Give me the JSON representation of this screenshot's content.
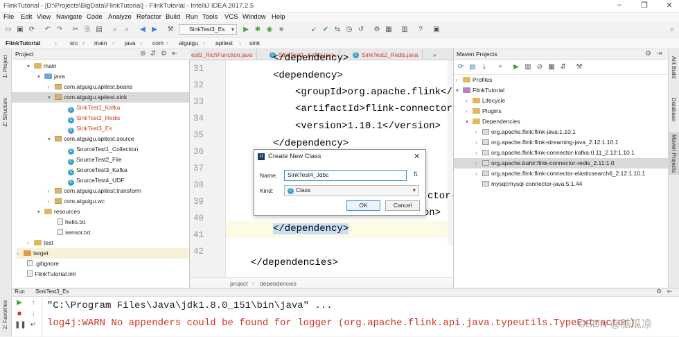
{
  "window": {
    "title": "FlinkTutorial - [D:\\Projects\\BigData\\FlinkTutorial] - FlinkTutorial - IntelliJ IDEA 2017.2.5"
  },
  "menu": [
    "File",
    "Edit",
    "View",
    "Navigate",
    "Code",
    "Analyze",
    "Refactor",
    "Build",
    "Run",
    "Tools",
    "VCS",
    "Window",
    "Help"
  ],
  "toolbar": {
    "run_config": "SinkTest3_Es"
  },
  "breadcrumb": [
    "FlinkTutorial",
    "src",
    "main",
    "java",
    "com",
    "atguigu",
    "apitest",
    "sink"
  ],
  "left_strip": {
    "project": "1: Project",
    "structure": "Z: Structure",
    "favorites": "2: Favorites"
  },
  "project_panel": {
    "header": "Project",
    "tree": [
      {
        "label": "main",
        "type": "folder"
      },
      {
        "label": "java",
        "type": "folder"
      },
      {
        "label": "com.atguigu.apitest.beans",
        "type": "pkg"
      },
      {
        "label": "com.atguigu.apitest.sink",
        "type": "pkg"
      },
      {
        "label": "SinkTest1_Kafka",
        "type": "cls"
      },
      {
        "label": "SinkTest2_Redis",
        "type": "cls"
      },
      {
        "label": "SinkTest3_Es",
        "type": "cls"
      },
      {
        "label": "com.atguigu.apitest.source",
        "type": "pkg"
      },
      {
        "label": "SourceTest1_Collection",
        "type": "cls"
      },
      {
        "label": "SourceTest2_File",
        "type": "cls"
      },
      {
        "label": "SourceTest3_Kafka",
        "type": "cls"
      },
      {
        "label": "SourceTest4_UDF",
        "type": "cls"
      },
      {
        "label": "com.atguigu.apitest.transform",
        "type": "pkg"
      },
      {
        "label": "com.atguigu.wc",
        "type": "pkg"
      },
      {
        "label": "resources",
        "type": "folder"
      },
      {
        "label": "hello.txt",
        "type": "file"
      },
      {
        "label": "sensor.txt",
        "type": "file"
      },
      {
        "label": "test",
        "type": "folder"
      },
      {
        "label": "target",
        "type": "folder"
      },
      {
        "label": ".gitignore",
        "type": "file"
      },
      {
        "label": "FlinkTutorial.iml",
        "type": "file"
      }
    ]
  },
  "editor": {
    "tabs": [
      "est5_RichFunction.java",
      "SinkTest1_Kafka.java",
      "SinkTest2_Redis.java"
    ],
    "line_numbers": [
      "31",
      "32",
      "33",
      "34",
      "35",
      "36",
      "37",
      "38",
      "39",
      "40",
      "41",
      "42"
    ],
    "lines": {
      "l31": "</dependency>",
      "l32": "<dependency>",
      "l33g": "<groupId>",
      "l33v": "org.apache.flink",
      "l33c": "</gr",
      "l34a": "<artifactId>",
      "l34v": "flink-connector-e",
      "l35v": "<version>",
      "l35n": "1.10.1",
      "l35c": "</version>",
      "l36": "</dependency>",
      "l38": "ctor-j",
      "l39a": "<version>",
      "l39b": "5.1.44",
      "l39c": "</version>",
      "l40": "</dependency>",
      "l42": "</dependencies>"
    },
    "crumbs": [
      "project",
      "dependencies"
    ]
  },
  "dialog": {
    "title": "Create New Class",
    "name_label": "Name:",
    "name_value": "SinkTest4_Jdbc",
    "kind_label": "Kind:",
    "kind_value": "Class",
    "ok": "OK",
    "cancel": "Cancel"
  },
  "maven": {
    "header": "Maven Projects",
    "items": [
      {
        "label": "Profiles",
        "indent": 0
      },
      {
        "label": "FlinkTutorial",
        "indent": 0
      },
      {
        "label": "Lifecycle",
        "indent": 1
      },
      {
        "label": "Plugins",
        "indent": 1
      },
      {
        "label": "Dependencies",
        "indent": 1
      },
      {
        "label": "org.apache.flink:flink-java:1.10.1",
        "indent": 2
      },
      {
        "label": "org.apache.flink:flink-streaming-java_2.12:1.10.1",
        "indent": 2
      },
      {
        "label": "org.apache.flink:flink-connector-kafka-0.11_2.12:1.10.1",
        "indent": 2
      },
      {
        "label": "org.apache.bahir:flink-connector-redis_2.11:1.0",
        "indent": 2
      },
      {
        "label": "org.apache.flink:flink-connector-elasticsearch6_2.12:1.10.1",
        "indent": 2
      },
      {
        "label": "mysql:mysql-connector-java:5.1.44",
        "indent": 2
      }
    ]
  },
  "right_strip": {
    "ant": "Ant Build",
    "database": "Database",
    "maven": "Maven Projects"
  },
  "run": {
    "label": "Run",
    "tab": "SinkTest3_Es",
    "line1": "\"C:\\Program Files\\Java\\jdk1.8.0_151\\bin\\java\" ...",
    "line2": "log4j:WARN No appenders could be found for logger (org.apache.flink.api.java.typeutils.TypeExtractor).",
    "watermark": "CSDN @脑瓜凉"
  }
}
